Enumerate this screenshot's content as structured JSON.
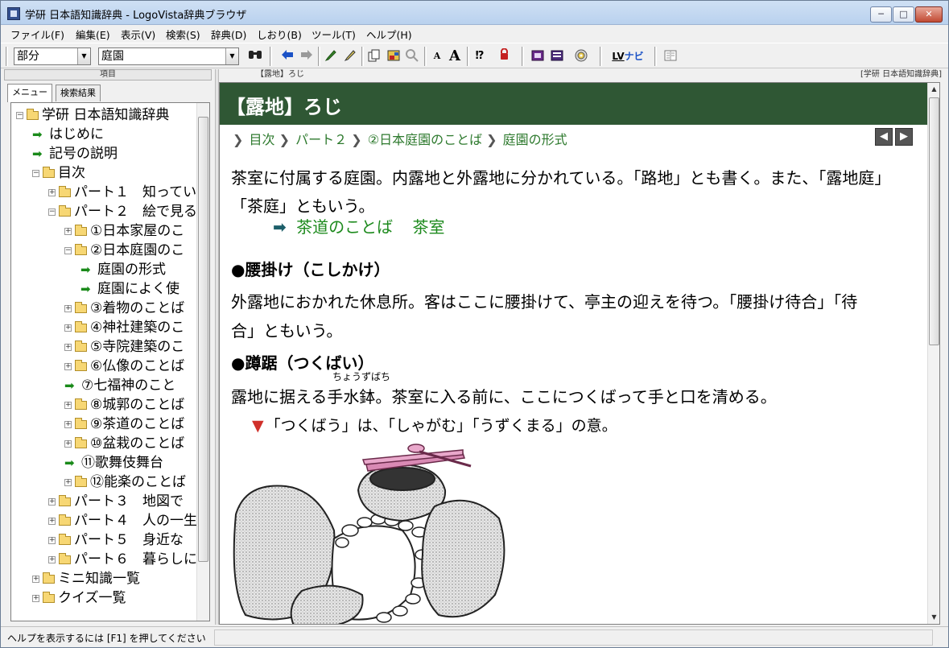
{
  "window": {
    "title": "学研 日本語知識辞典 - LogoVista辞典ブラウザ",
    "min": "─",
    "max": "□",
    "close": "✕"
  },
  "menu": [
    "ファイル(F)",
    "編集(E)",
    "表示(V)",
    "検索(S)",
    "辞典(D)",
    "しおり(B)",
    "ツール(T)",
    "ヘルプ(H)"
  ],
  "toolbar": {
    "match_mode": "部分",
    "search_value": "庭園",
    "dropdown_glyph": "▼",
    "nav_label": "ナビ",
    "nav_logo": "LV",
    "icons": [
      "search-icon",
      "back-icon",
      "forward-icon",
      "marker-icon",
      "pen-icon",
      "copy-icon",
      "image-icon",
      "zoom-icon",
      "font-smaller-icon",
      "font-larger-icon",
      "help-query-icon",
      "stop-icon",
      "dictionary-icon",
      "dictionary-list-icon",
      "cd-icon",
      "columns-icon"
    ]
  },
  "left_pane": {
    "column_header": "項目",
    "tabs": [
      "メニュー",
      "検索結果"
    ],
    "tree": [
      {
        "label": "学研 日本語知識辞典",
        "type": "folder",
        "pm": "⊟",
        "indent": 0
      },
      {
        "label": "はじめに",
        "type": "item",
        "indent": 1
      },
      {
        "label": "記号の説明",
        "type": "item",
        "indent": 1
      },
      {
        "label": "目次",
        "type": "folder",
        "pm": "⊟",
        "indent": 1
      },
      {
        "label": "パート１　知ってい",
        "type": "folder",
        "pm": "⊞",
        "indent": 2
      },
      {
        "label": "パート２　絵で見る",
        "type": "folder",
        "pm": "⊟",
        "indent": 2
      },
      {
        "label": "①日本家屋のこ",
        "type": "folder",
        "pm": "⊞",
        "indent": 3
      },
      {
        "label": "②日本庭園のこ",
        "type": "folder",
        "pm": "⊟",
        "indent": 3
      },
      {
        "label": "庭園の形式",
        "type": "item",
        "indent": 4
      },
      {
        "label": "庭園によく使",
        "type": "item",
        "indent": 4
      },
      {
        "label": "③着物のことば",
        "type": "folder",
        "pm": "⊞",
        "indent": 3
      },
      {
        "label": "④神社建築のこ",
        "type": "folder",
        "pm": "⊞",
        "indent": 3
      },
      {
        "label": "⑤寺院建築のこ",
        "type": "folder",
        "pm": "⊞",
        "indent": 3
      },
      {
        "label": "⑥仏像のことば",
        "type": "folder",
        "pm": "⊞",
        "indent": 3
      },
      {
        "label": "⑦七福神のこと",
        "type": "item",
        "indent": 3
      },
      {
        "label": "⑧城郭のことば",
        "type": "folder",
        "pm": "⊞",
        "indent": 3
      },
      {
        "label": "⑨茶道のことば",
        "type": "folder",
        "pm": "⊞",
        "indent": 3
      },
      {
        "label": "⑩盆栽のことば",
        "type": "folder",
        "pm": "⊞",
        "indent": 3
      },
      {
        "label": "⑪歌舞伎舞台",
        "type": "item",
        "indent": 3
      },
      {
        "label": "⑫能楽のことば",
        "type": "folder",
        "pm": "⊞",
        "indent": 3
      },
      {
        "label": "パート３　地図で",
        "type": "folder",
        "pm": "⊞",
        "indent": 2
      },
      {
        "label": "パート４　人の一生",
        "type": "folder",
        "pm": "⊞",
        "indent": 2
      },
      {
        "label": "パート５　身近な",
        "type": "folder",
        "pm": "⊞",
        "indent": 2
      },
      {
        "label": "パート６　暮らしに",
        "type": "folder",
        "pm": "⊞",
        "indent": 2
      },
      {
        "label": "ミニ知識一覧",
        "type": "folder",
        "pm": "⊞",
        "indent": 1
      },
      {
        "label": "クイズ一覧",
        "type": "folder",
        "pm": "⊞",
        "indent": 1
      }
    ]
  },
  "right_pane": {
    "header_left": "【露地】ろじ",
    "header_right": "[学研 日本語知識辞典]",
    "entry_title": "【露地】ろじ",
    "breadcrumb": [
      "目次",
      "パート２",
      "②日本庭園のことば",
      "庭園の形式"
    ],
    "breadcrumb_sep": "❯",
    "nav_prev": "◀",
    "nav_next": "▶",
    "para1_line1": "茶室に付属する庭園。内露地と外露地に分かれている。「路地」とも書く。また、「露地庭」",
    "para1_line2": "「茶庭」ともいう。",
    "link_arrow": "➡",
    "related_links": [
      "茶道のことば",
      "茶室"
    ],
    "heading1": "●腰掛け（こしかけ）",
    "para2_line1": "外露地におかれた休息所。客はここに腰掛けて、亭主の迎えを待つ。「腰掛け待合」「待",
    "para2_line2": "合」ともいう。",
    "heading2": "●蹲踞（つくばい）",
    "ruby": "ちょうずばち",
    "para3": "露地に据える手水鉢。茶室に入る前に、ここにつくばって手と口を清める。",
    "note_mark": "▼",
    "note": "「つくばう」は、「しゃがむ」「うずくまる」の意。"
  },
  "statusbar": {
    "text": "ヘルプを表示するには [F1] を押してください"
  },
  "colors": {
    "entry_bar": "#2f5734",
    "link_green": "#1d8a1d",
    "note_red": "#d0302a"
  }
}
